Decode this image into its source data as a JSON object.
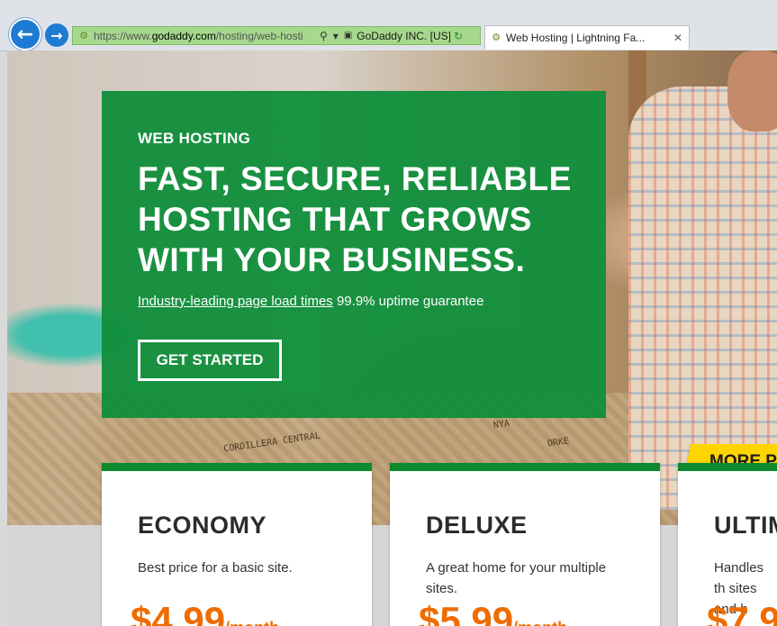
{
  "browser": {
    "back_icon": "back-arrow-icon",
    "forward_icon": "forward-arrow-icon",
    "address": {
      "scheme": "https://www.",
      "host": "godaddy.com",
      "path": "/hosting/web-hosti",
      "search_icon": "⚲",
      "dropdown_icon": "▾",
      "lock_icon": "🔒",
      "cert_label": "GoDaddy INC. [US]",
      "refresh_icon": "↻"
    },
    "tab": {
      "title": "Web Hosting | Lightning Fa...",
      "close": "✕"
    }
  },
  "hero": {
    "eyebrow": "WEB HOSTING",
    "headline": "FAST, SECURE, RELIABLE HOSTING THAT GROWS WITH YOUR BUSINESS.",
    "sub_link": "Industry-leading page load times",
    "sub_text": " 99.9% uptime guarantee",
    "cta_label": "GET STARTED",
    "sack_labels": [
      "CORDILLERA CENTRAL",
      "NYA",
      "ORKE"
    ]
  },
  "plans": [
    {
      "name": "ECONOMY",
      "description": "Best price for a basic site.",
      "price": "$4.99",
      "period": "/month"
    },
    {
      "name": "DELUXE",
      "description": "A great home for your multiple sites.",
      "price": "$5.99",
      "period": "/month"
    },
    {
      "name": "ULTIM",
      "description": "Handles th sites and h",
      "price": "$7.9",
      "period": ""
    }
  ],
  "badge": {
    "label": "MORE PO"
  },
  "colors": {
    "brand_green": "#118f3b",
    "card_accent": "#0b8a2e",
    "price_orange": "#ef6c00",
    "badge_yellow": "#ffd500"
  }
}
